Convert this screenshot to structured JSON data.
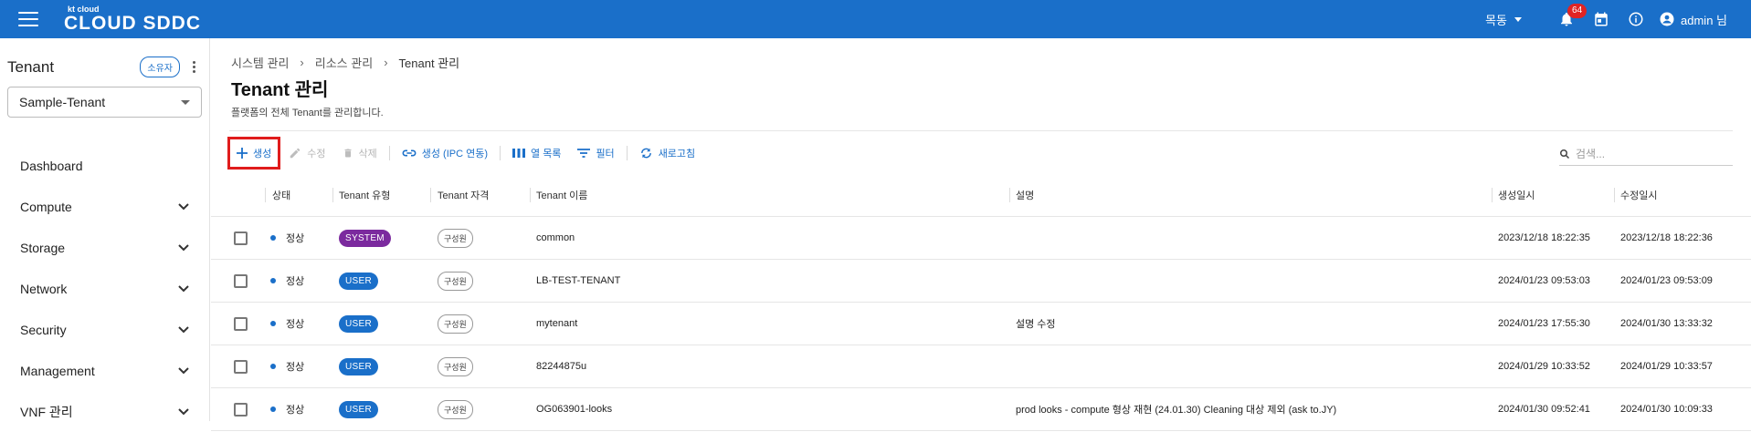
{
  "topbar": {
    "logo_small": "kt cloud",
    "logo_big": "CLOUD SDDC",
    "locale": "목동",
    "notification_count": "64",
    "user": "admin 님",
    "color": "#1a6fc9"
  },
  "sidebar": {
    "tenant_title": "Tenant",
    "owner_chip": "소유자",
    "tenant_selected": "Sample-Tenant",
    "items": [
      {
        "label": "Dashboard",
        "expandable": false
      },
      {
        "label": "Compute",
        "expandable": true
      },
      {
        "label": "Storage",
        "expandable": true
      },
      {
        "label": "Network",
        "expandable": true
      },
      {
        "label": "Security",
        "expandable": true
      },
      {
        "label": "Management",
        "expandable": true
      },
      {
        "label": "VNF 관리",
        "expandable": true
      }
    ]
  },
  "breadcrumb": [
    "시스템 관리",
    "리소스 관리",
    "Tenant 관리"
  ],
  "page": {
    "title": "Tenant 관리",
    "description": "플랫폼의 전체 Tenant를 관리합니다."
  },
  "toolbar": {
    "create": "생성",
    "edit": "수정",
    "delete": "삭제",
    "create_ipc": "생성 (IPC 연동)",
    "columns": "열 목록",
    "filter": "필터",
    "refresh": "새로고침",
    "search_placeholder": "검색..."
  },
  "table": {
    "headers": {
      "status": "상태",
      "type": "Tenant 유형",
      "role": "Tenant 자격",
      "name": "Tenant 이름",
      "desc": "설명",
      "created": "생성일시",
      "updated": "수정일시"
    },
    "rows": [
      {
        "status": "정상",
        "type": "SYSTEM",
        "type_color": "#7b2a9e",
        "role": "구성원",
        "name": "common",
        "desc": "",
        "created": "2023/12/18 18:22:35",
        "updated": "2023/12/18 18:22:36"
      },
      {
        "status": "정상",
        "type": "USER",
        "type_color": "#1a6fc9",
        "role": "구성원",
        "name": "LB-TEST-TENANT",
        "desc": "",
        "created": "2024/01/23 09:53:03",
        "updated": "2024/01/23 09:53:09"
      },
      {
        "status": "정상",
        "type": "USER",
        "type_color": "#1a6fc9",
        "role": "구성원",
        "name": "mytenant",
        "desc": "설명 수정",
        "created": "2024/01/23 17:55:30",
        "updated": "2024/01/30 13:33:32"
      },
      {
        "status": "정상",
        "type": "USER",
        "type_color": "#1a6fc9",
        "role": "구성원",
        "name": "82244875u",
        "desc": "",
        "created": "2024/01/29 10:33:52",
        "updated": "2024/01/29 10:33:57"
      },
      {
        "status": "정상",
        "type": "USER",
        "type_color": "#1a6fc9",
        "role": "구성원",
        "name": "OG063901-looks",
        "desc": "prod looks - compute 형상 재현 (24.01.30) Cleaning 대상 제외 (ask to.JY)",
        "created": "2024/01/30 09:52:41",
        "updated": "2024/01/30 10:09:33"
      }
    ]
  }
}
